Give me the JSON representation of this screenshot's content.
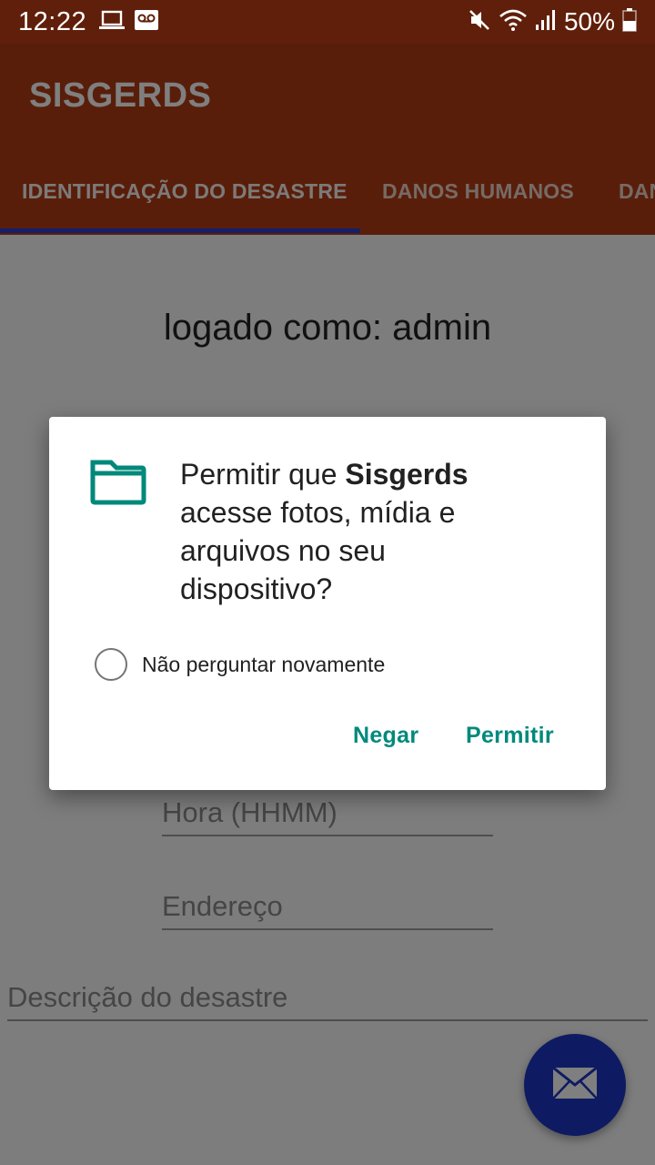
{
  "status_bar": {
    "time": "12:22",
    "battery": "50%",
    "icons": [
      "laptop-icon",
      "voicemail-icon",
      "mute-icon",
      "wifi-icon",
      "signal-icon",
      "battery-icon"
    ]
  },
  "app_bar": {
    "title": "SISGERDS",
    "tabs": [
      {
        "label": "IDENTIFICAÇÃO DO DESASTRE",
        "active": true
      },
      {
        "label": "DANOS HUMANOS",
        "active": false
      },
      {
        "label": "DAN",
        "active": false
      }
    ]
  },
  "content": {
    "logged_as": "logado como: admin",
    "fields": {
      "hora": "Hora (HHMM)",
      "endereco": "Endereço",
      "descricao": "Descrição do desastre"
    },
    "fab_icon": "mail-icon"
  },
  "dialog": {
    "icon": "folder-icon",
    "message_prefix": "Permitir que ",
    "app_name": "Sisgerds",
    "message_suffix": " acesse fotos, mídia e arquivos no seu dispositivo?",
    "checkbox_label": "Não perguntar novamente",
    "deny_label": "Negar",
    "allow_label": "Permitir"
  },
  "colors": {
    "status_bar": "#601f0a",
    "app_bar": "#b33c15",
    "tab_indicator": "#2a3dd6",
    "fab": "#1d36c4",
    "dialog_accent": "#00897b"
  }
}
